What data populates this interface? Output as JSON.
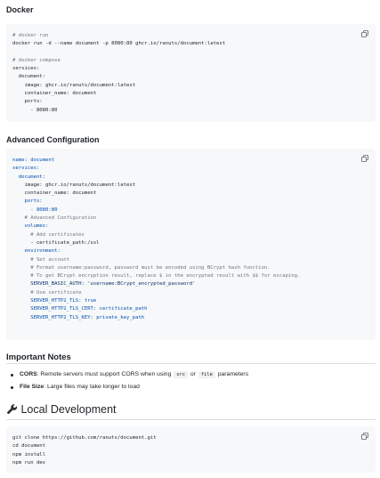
{
  "docker": {
    "title": "Docker",
    "lines": [
      {
        "t": "# docker run",
        "c": "cmt"
      },
      {
        "t": "docker run -d --name document -p 8080:80 ghcr.io/ranuts/document:latest",
        "c": ""
      },
      {
        "t": "",
        "c": ""
      },
      {
        "t": "# docker compose",
        "c": "cmt"
      },
      {
        "t": "services:",
        "c": ""
      },
      {
        "t": "  document:",
        "c": ""
      },
      {
        "t": "    image: ghcr.io/ranuts/document:latest",
        "c": ""
      },
      {
        "t": "    container_name: document",
        "c": ""
      },
      {
        "t": "    ports:",
        "c": ""
      },
      {
        "t": "      - 8080:80",
        "c": ""
      }
    ]
  },
  "advanced": {
    "title": "Advanced Configuration",
    "lines": [
      {
        "t": "name: document",
        "c": "key"
      },
      {
        "t": "services:",
        "c": "key"
      },
      {
        "t": "  document:",
        "c": "key"
      },
      {
        "t": "    image: ghcr.io/ranuts/document:latest",
        "c": ""
      },
      {
        "t": "    container_name: document",
        "c": ""
      },
      {
        "t": "    ports:",
        "c": "key"
      },
      {
        "t": "      - 8080:80",
        "c": "key"
      },
      {
        "t": "    # Advanced Configuration",
        "c": "cmt"
      },
      {
        "t": "    volumes:",
        "c": "key"
      },
      {
        "t": "      # Add certificates",
        "c": "cmt"
      },
      {
        "t": "      - certificate_path:/ssl",
        "c": ""
      },
      {
        "t": "    environment:",
        "c": "key"
      },
      {
        "t": "      # Set account",
        "c": "cmt"
      },
      {
        "t": "      # Format username:password, password must be encoded using BCrypt hash function.",
        "c": "cmt"
      },
      {
        "t": "      # To get BCrypt encryption result, replace $ in the encrypted result with $$ for escaping.",
        "c": "cmt"
      },
      {
        "t": "      SERVER_BASIC_AUTH: 'username:BCrypt_encrypted_password'",
        "c": "str"
      },
      {
        "t": "      # Use certificate",
        "c": "cmt"
      },
      {
        "t": "      SERVER_HTTP2_TLS: true",
        "c": "key"
      },
      {
        "t": "      SERVER_HTTP2_TLS_CERT: certificate_path",
        "c": "key"
      },
      {
        "t": "      SERVER_HTTP2_TLS_KEY: private_key_path",
        "c": "key"
      }
    ]
  },
  "notes": {
    "title": "Important Notes",
    "items": [
      {
        "label": "CORS",
        "text_before": ": Remote servers must support CORS when using ",
        "code1": "src",
        "mid": " or ",
        "code2": "file",
        "text_after": " parameters"
      },
      {
        "label": "File Size",
        "text_before": ": Large files may take longer to load",
        "code1": "",
        "mid": "",
        "code2": "",
        "text_after": ""
      }
    ]
  },
  "local": {
    "title": "Local Development",
    "emoji": "🔧",
    "lines": [
      {
        "t": "git clone https://github.com/ranuts/document.git",
        "c": ""
      },
      {
        "t": "cd document",
        "c": ""
      },
      {
        "t": "npm install",
        "c": ""
      },
      {
        "t": "npm run dev",
        "c": ""
      }
    ]
  },
  "icons": {
    "copy": "copy-icon",
    "wrench": "wrench-icon"
  }
}
